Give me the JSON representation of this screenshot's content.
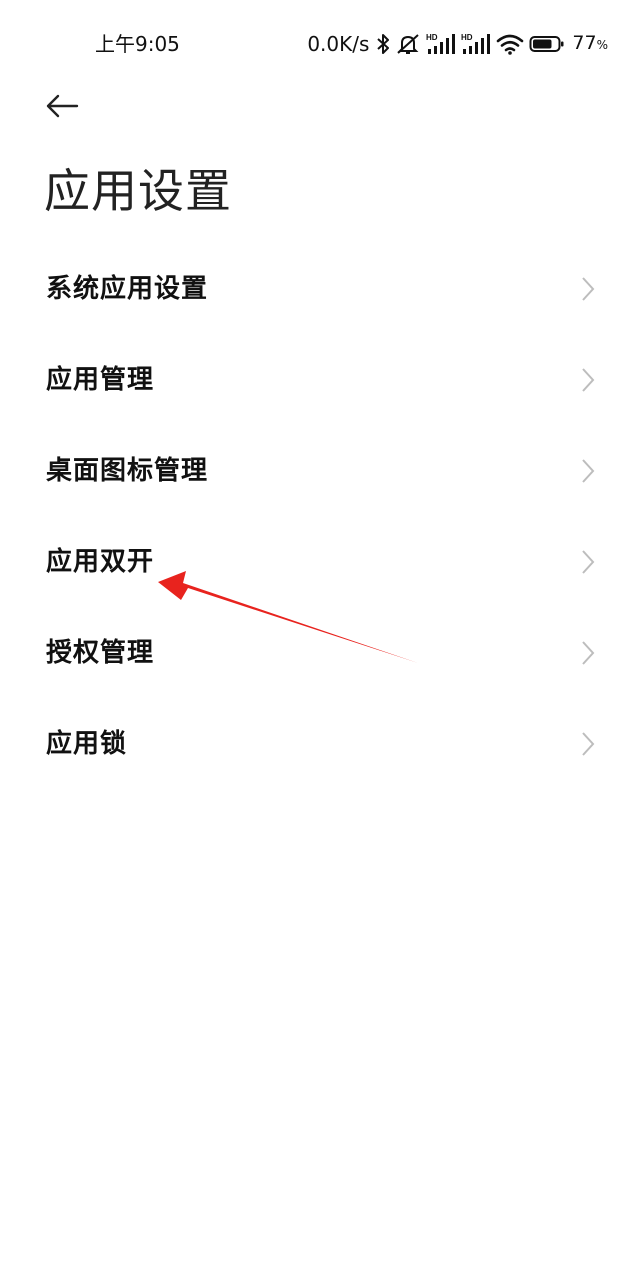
{
  "status_bar": {
    "time": "上午9:05",
    "net_speed": "0.0K/s",
    "battery_percent": "77",
    "battery_unit": "%",
    "battery_level": 0.77,
    "icons": [
      "bluetooth-icon",
      "mute-icon",
      "hd-signal-icon",
      "hd-signal-icon",
      "wifi-icon",
      "battery-icon"
    ]
  },
  "header": {
    "back_icon": "arrow-left-icon",
    "title": "应用设置"
  },
  "settings": {
    "items": [
      {
        "label": "系统应用设置"
      },
      {
        "label": "应用管理"
      },
      {
        "label": "桌面图标管理"
      },
      {
        "label": "应用双开"
      },
      {
        "label": "授权管理"
      },
      {
        "label": "应用锁"
      }
    ],
    "chevron_icon": "chevron-right-icon"
  },
  "colors": {
    "background": "#ffffff",
    "text": "#111111",
    "chevron": "#bdbdbd",
    "annotation": "#e8231e"
  }
}
